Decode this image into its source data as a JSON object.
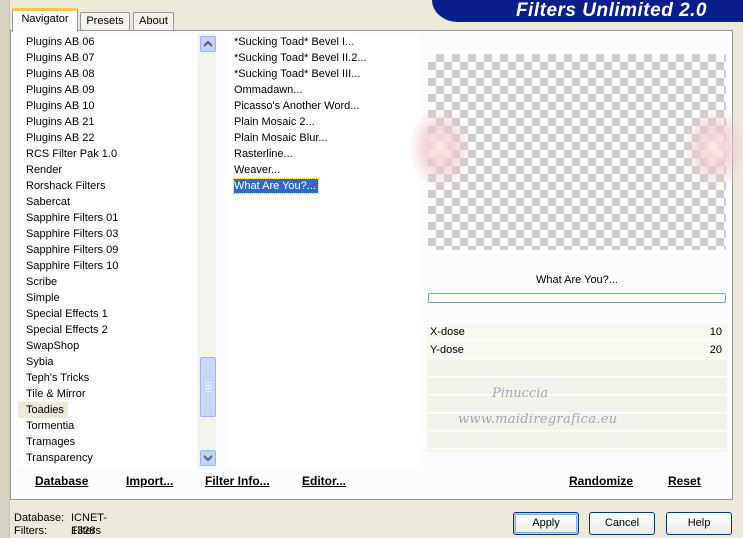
{
  "banner": {
    "title": "Filters Unlimited 2.0"
  },
  "tabs": [
    {
      "label": "Navigator",
      "active": true
    },
    {
      "label": "Presets",
      "active": false
    },
    {
      "label": "About",
      "active": false
    }
  ],
  "categories": [
    "Plugins AB 06",
    "Plugins AB 07",
    "Plugins AB 08",
    "Plugins AB 09",
    "Plugins AB 10",
    "Plugins AB 21",
    "Plugins AB 22",
    "RCS Filter Pak 1.0",
    "Render",
    "Rorshack Filters",
    "Sabercat",
    "Sapphire Filters 01",
    "Sapphire Filters 03",
    "Sapphire Filters 09",
    "Sapphire Filters 10",
    "Scribe",
    "Simple",
    "Special Effects 1",
    "Special Effects 2",
    "SwapShop",
    "Sybia",
    "Teph's Tricks",
    "Tile & Mirror",
    "Toadies",
    "Tormentia",
    "Tramages",
    "Transparency"
  ],
  "selected_category": "Toadies",
  "filters": [
    "*Sucking Toad*  Bevel I...",
    "*Sucking Toad*  Bevel II.2...",
    "*Sucking Toad*  Bevel III...",
    "Ommadawn...",
    "Picasso's Another Word...",
    "Plain Mosaic 2...",
    "Plain Mosaic Blur...",
    "Rasterline...",
    "Weaver...",
    "What Are You?..."
  ],
  "selected_filter": "What Are You?...",
  "preview": {
    "filter_name": "What Are You?...",
    "progress_percent": 0
  },
  "params": [
    {
      "label": "X-dose",
      "value": "10"
    },
    {
      "label": "Y-dose",
      "value": "20"
    }
  ],
  "watermark": {
    "line1": "Pinuccia",
    "line2": "www.maidiregrafica.eu"
  },
  "toolbar": {
    "database": "Database",
    "import": "Import...",
    "filter_info": "Filter Info...",
    "editor": "Editor...",
    "randomize": "Randomize",
    "reset": "Reset"
  },
  "status": {
    "database_label": "Database:",
    "database_value": "ICNET-Filters",
    "filters_label": "Filters:",
    "filters_value": "1328"
  },
  "buttons": {
    "apply": "Apply",
    "cancel": "Cancel",
    "help": "Help"
  },
  "colors": {
    "banner": "#0B1E8C",
    "selection": "#316AC5",
    "window_bg": "#ECE9D8"
  }
}
